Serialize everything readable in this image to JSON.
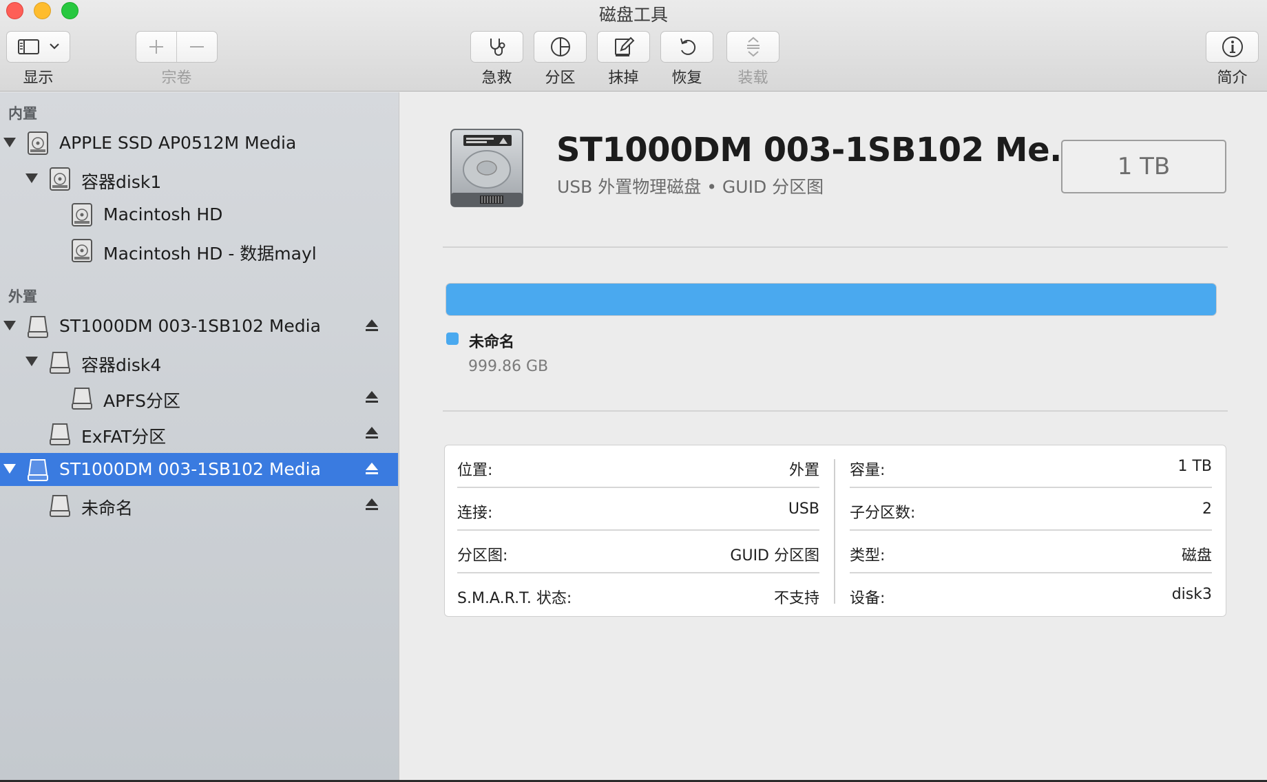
{
  "window": {
    "title": "磁盘工具"
  },
  "toolbar": {
    "view_label": "显示",
    "volume_label": "宗卷",
    "first_aid_label": "急救",
    "partition_label": "分区",
    "erase_label": "抹掉",
    "restore_label": "恢复",
    "mount_label": "装载",
    "info_label": "简介"
  },
  "sidebar": {
    "internal_header": "内置",
    "external_header": "外置",
    "internal_items": [
      {
        "label": "APPLE SSD AP0512M Media"
      },
      {
        "label": "容器disk1"
      },
      {
        "label": "Macintosh HD"
      },
      {
        "label": "Macintosh HD - 数据mayl"
      }
    ],
    "external_items": [
      {
        "label": "ST1000DM 003-1SB102 Media"
      },
      {
        "label": "容器disk4"
      },
      {
        "label": "APFS分区"
      },
      {
        "label": "ExFAT分区"
      },
      {
        "label": "ST1000DM 003-1SB102 Media"
      },
      {
        "label": "未命名"
      }
    ]
  },
  "detail": {
    "name": "ST1000DM 003-1SB102 Me...",
    "subtitle": "USB 外置物理磁盘 • GUID 分区图",
    "capacity": "1 TB",
    "usage": {
      "fraction": 1.0,
      "color": "#4aa9ef",
      "volume_name": "未命名",
      "volume_size": "999.86 GB"
    },
    "info_left": [
      {
        "key": "位置:",
        "value": "外置"
      },
      {
        "key": "连接:",
        "value": "USB"
      },
      {
        "key": "分区图:",
        "value": "GUID 分区图"
      },
      {
        "key": "S.M.A.R.T. 状态:",
        "value": "不支持"
      }
    ],
    "info_right": [
      {
        "key": "容量:",
        "value": "1 TB"
      },
      {
        "key": "子分区数:",
        "value": "2"
      },
      {
        "key": "类型:",
        "value": "磁盘"
      },
      {
        "key": "设备:",
        "value": "disk3"
      }
    ]
  },
  "colors": {
    "selection": "#3a7be0",
    "accent_blue": "#4aa9ef"
  }
}
